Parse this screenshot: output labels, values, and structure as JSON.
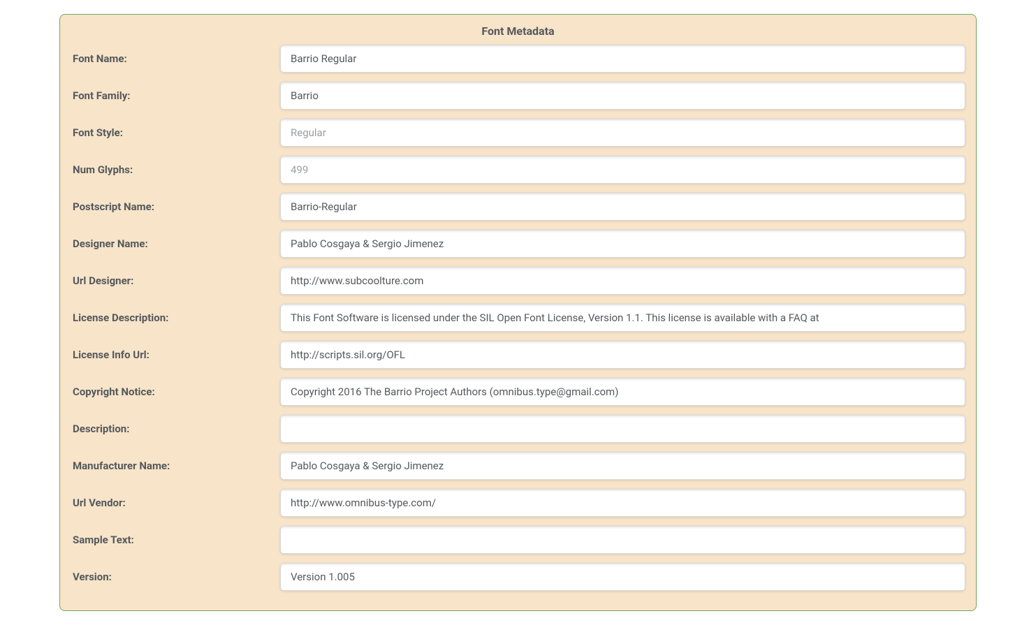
{
  "panel": {
    "title": "Font Metadata",
    "fields": [
      {
        "label": "Font Name:",
        "value": "Barrio Regular",
        "readonly": false,
        "name": "font-name"
      },
      {
        "label": "Font Family:",
        "value": "Barrio",
        "readonly": false,
        "name": "font-family"
      },
      {
        "label": "Font Style:",
        "value": "Regular",
        "readonly": true,
        "name": "font-style"
      },
      {
        "label": "Num Glyphs:",
        "value": "499",
        "readonly": true,
        "name": "num-glyphs"
      },
      {
        "label": "Postscript Name:",
        "value": "Barrio-Regular",
        "readonly": false,
        "name": "postscript-name"
      },
      {
        "label": "Designer Name:",
        "value": "Pablo Cosgaya & Sergio Jimenez",
        "readonly": false,
        "name": "designer-name"
      },
      {
        "label": "Url Designer:",
        "value": "http://www.subcoolture.com",
        "readonly": false,
        "name": "url-designer"
      },
      {
        "label": "License Description:",
        "value": "This Font Software is licensed under the SIL Open Font License, Version 1.1. This license is available with a FAQ at",
        "readonly": false,
        "name": "license-description"
      },
      {
        "label": "License Info Url:",
        "value": "http://scripts.sil.org/OFL",
        "readonly": false,
        "name": "license-info-url"
      },
      {
        "label": "Copyright Notice:",
        "value": "Copyright 2016 The Barrio Project Authors (omnibus.type@gmail.com)",
        "readonly": false,
        "name": "copyright-notice"
      },
      {
        "label": "Description:",
        "value": "",
        "readonly": false,
        "name": "description"
      },
      {
        "label": "Manufacturer Name:",
        "value": "Pablo Cosgaya & Sergio Jimenez",
        "readonly": false,
        "name": "manufacturer-name"
      },
      {
        "label": "Url Vendor:",
        "value": "http://www.omnibus-type.com/",
        "readonly": false,
        "name": "url-vendor"
      },
      {
        "label": "Sample Text:",
        "value": "",
        "readonly": false,
        "name": "sample-text"
      },
      {
        "label": "Version:",
        "value": "Version 1.005",
        "readonly": false,
        "name": "version"
      }
    ]
  }
}
